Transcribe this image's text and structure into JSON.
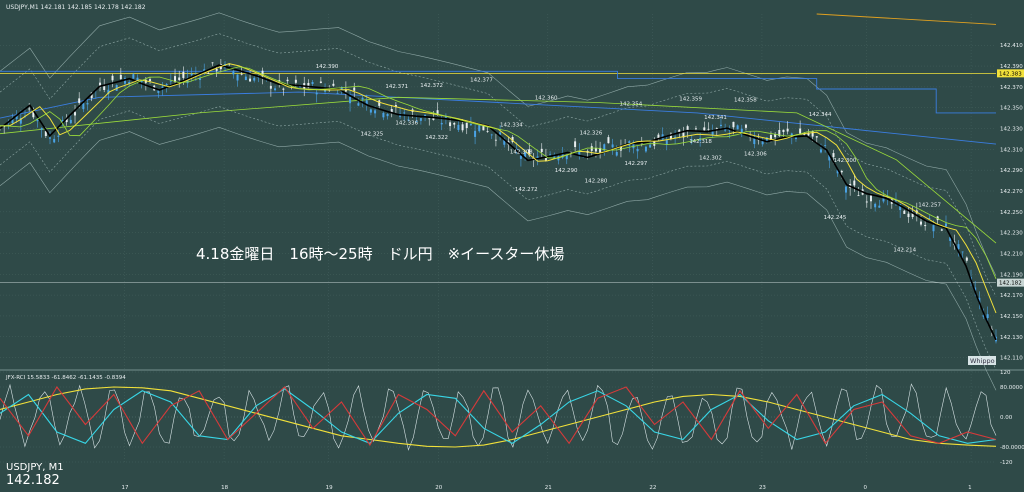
{
  "window": {
    "header_info": "USDJPY,M1  142.181 142.185 142.178 142.182",
    "footer_symbol": "USDJPY, M1",
    "footer_price": "142.182",
    "watermark": "Whippo"
  },
  "annotation": "4.18金曜日　16時～25時　ドル円　※イースター休場",
  "colors": {
    "background": "#2f4a48",
    "grid": "#46625f",
    "bull_candle": "#4aa3e6",
    "bear_candle": "#e8eef0",
    "ma_black": "#000000",
    "ma_yellow": "#f2e13a",
    "ma_green": "#9bdc3a",
    "band": "#8fa8a6",
    "red_line": "#d63a3a",
    "cyan_line": "#38d6e6",
    "white_line": "#d8e4e6",
    "blue_line": "#3a7de0",
    "orange_line": "#e0a020",
    "price_label_bg": "#f2e13a"
  },
  "chart_data": [
    {
      "type": "candlestick",
      "symbol": "USDJPY",
      "timeframe": "M1",
      "y_axis": {
        "ylim": [
          142.1,
          142.44
        ],
        "tick_labels": [
          "142.410",
          "142.390",
          "142.370",
          "142.350",
          "142.330",
          "142.310",
          "142.290",
          "142.270",
          "142.250",
          "142.230",
          "142.210",
          "142.190",
          "142.170",
          "142.150",
          "142.130",
          "142.110"
        ],
        "tick_values": [
          142.41,
          142.39,
          142.37,
          142.35,
          142.33,
          142.31,
          142.29,
          142.27,
          142.25,
          142.23,
          142.21,
          142.19,
          142.17,
          142.15,
          142.13,
          142.11
        ]
      },
      "x_axis": {
        "tick_labels": [
          "17",
          "18",
          "19",
          "20",
          "21",
          "22",
          "23",
          "0",
          "1"
        ],
        "tick_positions": [
          0.125,
          0.225,
          0.33,
          0.44,
          0.55,
          0.655,
          0.765,
          0.87,
          0.975
        ]
      },
      "current_price": 142.182,
      "highlight_price": {
        "label": "142.383",
        "value": 142.383
      },
      "price_labels": [
        {
          "label": "142.390",
          "x": 0.325,
          "value": 142.39
        },
        {
          "label": "142.371",
          "x": 0.395,
          "value": 142.371
        },
        {
          "label": "142.372",
          "x": 0.43,
          "value": 142.372
        },
        {
          "label": "142.377",
          "x": 0.48,
          "value": 142.377
        },
        {
          "label": "142.360",
          "x": 0.545,
          "value": 142.36
        },
        {
          "label": "142.354",
          "x": 0.63,
          "value": 142.354
        },
        {
          "label": "142.359",
          "x": 0.69,
          "value": 142.359
        },
        {
          "label": "142.358",
          "x": 0.745,
          "value": 142.358
        },
        {
          "label": "142.344",
          "x": 0.82,
          "value": 142.344
        },
        {
          "label": "142.341",
          "x": 0.715,
          "value": 142.341
        },
        {
          "label": "142.334",
          "x": 0.51,
          "value": 142.334
        },
        {
          "label": "142.326",
          "x": 0.59,
          "value": 142.326
        },
        {
          "label": "142.318",
          "x": 0.7,
          "value": 142.318
        },
        {
          "label": "142.325",
          "x": 0.37,
          "value": 142.325
        },
        {
          "label": "142.336",
          "x": 0.405,
          "value": 142.336
        },
        {
          "label": "142.322",
          "x": 0.435,
          "value": 142.322
        },
        {
          "label": "142.308",
          "x": 0.52,
          "value": 142.308
        },
        {
          "label": "142.306",
          "x": 0.755,
          "value": 142.306
        },
        {
          "label": "142.302",
          "x": 0.71,
          "value": 142.302
        },
        {
          "label": "142.297",
          "x": 0.635,
          "value": 142.297
        },
        {
          "label": "142.290",
          "x": 0.565,
          "value": 142.29
        },
        {
          "label": "142.280",
          "x": 0.595,
          "value": 142.28
        },
        {
          "label": "142.272",
          "x": 0.525,
          "value": 142.272
        },
        {
          "label": "142.300",
          "x": 0.845,
          "value": 142.3
        },
        {
          "label": "142.257",
          "x": 0.93,
          "value": 142.257
        },
        {
          "label": "142.245",
          "x": 0.835,
          "value": 142.245
        },
        {
          "label": "142.214",
          "x": 0.905,
          "value": 142.214
        }
      ],
      "price_path": [
        [
          0.0,
          142.33
        ],
        [
          0.03,
          142.35
        ],
        [
          0.05,
          142.32
        ],
        [
          0.07,
          142.34
        ],
        [
          0.1,
          142.37
        ],
        [
          0.13,
          142.38
        ],
        [
          0.16,
          142.37
        ],
        [
          0.19,
          142.38
        ],
        [
          0.22,
          142.39
        ],
        [
          0.25,
          142.38
        ],
        [
          0.28,
          142.37
        ],
        [
          0.31,
          142.37
        ],
        [
          0.34,
          142.37
        ],
        [
          0.37,
          142.355
        ],
        [
          0.4,
          142.345
        ],
        [
          0.43,
          142.34
        ],
        [
          0.46,
          142.335
        ],
        [
          0.49,
          142.33
        ],
        [
          0.51,
          142.315
        ],
        [
          0.53,
          142.3
        ],
        [
          0.55,
          142.305
        ],
        [
          0.57,
          142.31
        ],
        [
          0.59,
          142.305
        ],
        [
          0.61,
          142.31
        ],
        [
          0.63,
          142.315
        ],
        [
          0.65,
          142.315
        ],
        [
          0.67,
          142.32
        ],
        [
          0.69,
          142.325
        ],
        [
          0.71,
          142.325
        ],
        [
          0.73,
          142.33
        ],
        [
          0.75,
          142.325
        ],
        [
          0.77,
          142.32
        ],
        [
          0.79,
          142.325
        ],
        [
          0.81,
          142.325
        ],
        [
          0.83,
          142.31
        ],
        [
          0.85,
          142.275
        ],
        [
          0.87,
          142.265
        ],
        [
          0.89,
          142.26
        ],
        [
          0.91,
          142.25
        ],
        [
          0.93,
          142.24
        ],
        [
          0.95,
          142.235
        ],
        [
          0.97,
          142.2
        ],
        [
          0.985,
          142.16
        ],
        [
          1.0,
          142.13
        ]
      ]
    },
    {
      "type": "line",
      "indicator_label": "JFX-RCI 15.5833 -61.8462 -61.1435 -0.8394",
      "ylim": [
        -120,
        120
      ],
      "tick_labels": [
        "120",
        "80.0000",
        "0.00",
        "-80.0000",
        "-120"
      ],
      "tick_values": [
        120,
        80,
        0,
        -80,
        -120
      ],
      "series": [
        {
          "color_key": "ma_yellow",
          "values": [
            20,
            40,
            60,
            75,
            80,
            78,
            70,
            50,
            30,
            10,
            -10,
            -30,
            -50,
            -60,
            -70,
            -78,
            -80,
            -75,
            -60,
            -40,
            -20,
            0,
            20,
            40,
            55,
            60,
            55,
            40,
            20,
            0,
            -20,
            -40,
            -60,
            -70,
            -75,
            -78
          ]
        },
        {
          "color_key": "cyan_line",
          "values": [
            10,
            60,
            -40,
            -70,
            20,
            70,
            40,
            -50,
            -60,
            30,
            75,
            20,
            -40,
            -70,
            10,
            60,
            50,
            -30,
            -70,
            -20,
            40,
            70,
            30,
            -40,
            -60,
            20,
            60,
            -10,
            -60,
            -40,
            30,
            60,
            10,
            -50,
            -70,
            -60
          ]
        },
        {
          "color_key": "red_line",
          "values": [
            50,
            -50,
            80,
            -20,
            60,
            -70,
            30,
            70,
            -60,
            10,
            80,
            -30,
            40,
            -75,
            60,
            20,
            -50,
            70,
            -40,
            30,
            -70,
            50,
            80,
            -20,
            40,
            -60,
            70,
            -30,
            60,
            -70,
            20,
            40,
            -50,
            -70,
            -40,
            -60
          ]
        }
      ]
    }
  ]
}
